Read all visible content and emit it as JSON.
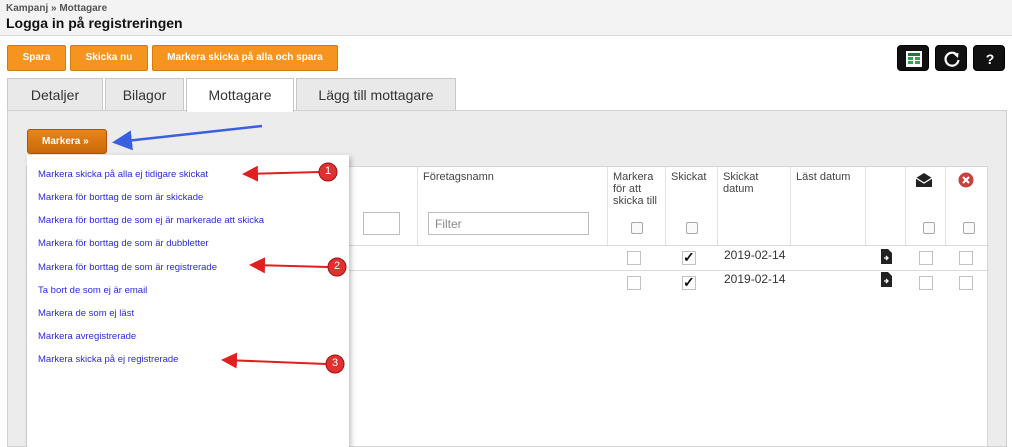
{
  "header": {
    "breadcrumb": "Kampanj » Mottagare",
    "title": "Logga in på registreringen"
  },
  "toolbar": {
    "save": "Spara",
    "send_now": "Skicka nu",
    "mark_all_save": "Markera skicka på alla och spara"
  },
  "icons": {
    "excel": "excel-export-icon",
    "refresh": "refresh-icon",
    "help": "help-icon"
  },
  "tabs": [
    {
      "label": "Detaljer"
    },
    {
      "label": "Bilagor"
    },
    {
      "label": "Mottagare"
    },
    {
      "label": "Lägg till mottagare"
    }
  ],
  "markera": {
    "label": "Markera »"
  },
  "dropdown": {
    "items": [
      "Markera skicka på alla ej tidigare skickat",
      "Markera för borttag de som är skickade",
      "Markera för borttag de som ej är markerade att skicka",
      "Markera för borttag de som är dubbletter",
      "Markera för borttag de som är registrerade",
      "Ta bort de som ej är email",
      "Markera de som ej läst",
      "Markera avregistrerade",
      "Markera skicka på ej registrerade"
    ]
  },
  "table": {
    "columns": {
      "company": "Företagsnamn",
      "mark_send": "Markera för att skicka till",
      "sent": "Skickat",
      "sent_date": "Skickat datum",
      "read_date": "Läst datum"
    },
    "filter_placeholder": "Filter",
    "rows": [
      {
        "sent_date": "2019-02-14",
        "sent": true
      },
      {
        "sent_date": "2019-02-14",
        "sent": true
      }
    ]
  },
  "annotations": [
    "1",
    "2",
    "3"
  ],
  "colors": {
    "orange": "#f5941e",
    "link": "#2a2ae0",
    "arrow_red": "#e02020",
    "arrow_blue": "#3a5fe0"
  }
}
